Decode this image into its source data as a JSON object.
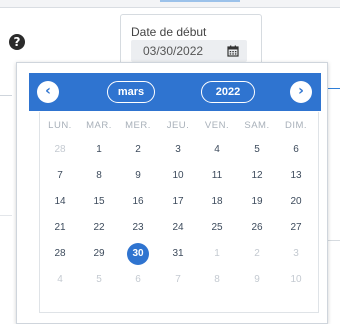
{
  "date_field": {
    "label": "Date de début",
    "value": "03/30/2022"
  },
  "calendar": {
    "month": "mars",
    "year": "2022",
    "prev_symbol": "‹",
    "next_symbol": "›",
    "weekdays": [
      "LUN.",
      "MAR.",
      "MER.",
      "JEU.",
      "VEN.",
      "SAM.",
      "DIM."
    ],
    "weeks": [
      [
        {
          "d": "28",
          "m": true
        },
        {
          "d": "1"
        },
        {
          "d": "2"
        },
        {
          "d": "3"
        },
        {
          "d": "4"
        },
        {
          "d": "5"
        },
        {
          "d": "6"
        }
      ],
      [
        {
          "d": "7"
        },
        {
          "d": "8"
        },
        {
          "d": "9"
        },
        {
          "d": "10"
        },
        {
          "d": "11"
        },
        {
          "d": "12"
        },
        {
          "d": "13"
        }
      ],
      [
        {
          "d": "14"
        },
        {
          "d": "15"
        },
        {
          "d": "16"
        },
        {
          "d": "17"
        },
        {
          "d": "18"
        },
        {
          "d": "19"
        },
        {
          "d": "20"
        }
      ],
      [
        {
          "d": "21"
        },
        {
          "d": "22"
        },
        {
          "d": "23"
        },
        {
          "d": "24"
        },
        {
          "d": "25"
        },
        {
          "d": "26"
        },
        {
          "d": "27"
        }
      ],
      [
        {
          "d": "28"
        },
        {
          "d": "29"
        },
        {
          "d": "30",
          "s": true
        },
        {
          "d": "31"
        },
        {
          "d": "1",
          "m": true
        },
        {
          "d": "2",
          "m": true
        },
        {
          "d": "3",
          "m": true
        }
      ],
      [
        {
          "d": "4",
          "m": true
        },
        {
          "d": "5",
          "m": true
        },
        {
          "d": "6",
          "m": true
        },
        {
          "d": "7",
          "m": true
        },
        {
          "d": "8",
          "m": true
        },
        {
          "d": "9",
          "m": true
        },
        {
          "d": "10",
          "m": true
        }
      ]
    ]
  },
  "colors": {
    "accent": "#2f74d0",
    "muted_text": "#c4cad1"
  },
  "icons": {
    "help": "question-circle-icon",
    "calendar": "calendar-icon"
  }
}
